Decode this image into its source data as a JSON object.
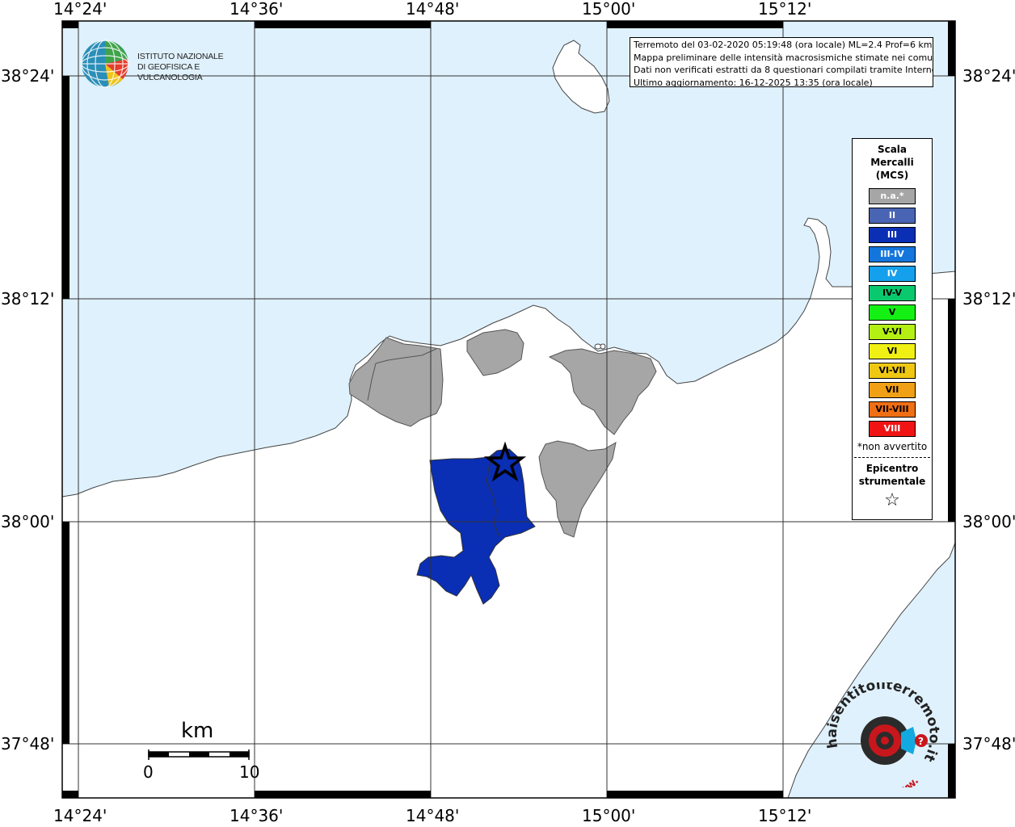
{
  "map": {
    "lon_labels": [
      "14°24'",
      "14°36'",
      "14°48'",
      "15°00'",
      "15°12'"
    ],
    "lat_labels": [
      "38°24'",
      "38°12'",
      "38°00'",
      "37°48'"
    ],
    "sea_color": "#dff1fc",
    "land_color": "#ffffff"
  },
  "info": {
    "line1": "Terremoto del 03-02-2020 05:19:48 (ora locale) ML=2.4 Prof=6 km",
    "line2": "Mappa preliminare delle intensità macrosismiche stimate nei comuni",
    "line3": "Dati non verificati estratti da 8 questionari compilati tramite Internet.",
    "line4": "Ultimo aggiornamento: 16-12-2025 13:35 (ora locale)"
  },
  "logo": {
    "line1": "ISTITUTO NAZIONALE",
    "line2": "DI GEOFISICA E VULCANOLOGIA"
  },
  "legend": {
    "title1": "Scala",
    "title2": "Mercalli",
    "title3": "(MCS)",
    "items": [
      {
        "label": "n.a.*",
        "color": "#a6a6a6"
      },
      {
        "label": "II",
        "color": "#4a64b4"
      },
      {
        "label": "III",
        "color": "#0a2eb4"
      },
      {
        "label": "III-IV",
        "color": "#1476dc"
      },
      {
        "label": "IV",
        "color": "#14a0ec"
      },
      {
        "label": "IV-V",
        "color": "#0ac86e"
      },
      {
        "label": "V",
        "color": "#14f014"
      },
      {
        "label": "V-VI",
        "color": "#b4f014"
      },
      {
        "label": "VI",
        "color": "#f0f014"
      },
      {
        "label": "VI-VII",
        "color": "#f0c814"
      },
      {
        "label": "VII",
        "color": "#f0a014"
      },
      {
        "label": "VII-VIII",
        "color": "#f06e14"
      },
      {
        "label": "VIII",
        "color": "#f01414"
      }
    ],
    "note": "*non avvertito",
    "epi1": "Epicentro",
    "epi2": "strumentale",
    "star": "☆"
  },
  "scalebar": {
    "unit": "km",
    "min": "0",
    "max": "10"
  },
  "website_logo": {
    "text": "haisentitoilterremoto.it",
    "prefix": "www."
  }
}
